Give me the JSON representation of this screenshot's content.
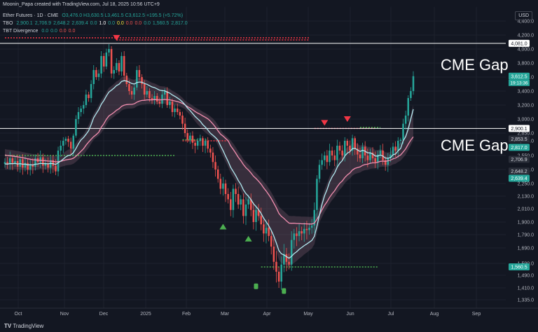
{
  "header": {
    "credit": "Moonin_Papa created with TradingView.com, Jul 18, 2025 10:56 UTC+9",
    "symbol_line": "Ether Futures · 1D · CME",
    "ohlc": "O3,476.0 H3,630.5 L3,461.5 C3,612.5 +195.5 (+5.72%)",
    "tbo_label": "TBO",
    "tbo_values": [
      "2,900.1",
      "2,706.9",
      "2,648.2",
      "2,639.4",
      "0.0",
      "1.0",
      "0.0",
      "0.0",
      "0.0",
      "0.0",
      "0.0",
      "1,560.5",
      "2,817.0"
    ],
    "tbt_label": "TBT Divergence",
    "tbt_values": [
      "0.0",
      "0.0",
      "0.0",
      "0.0"
    ]
  },
  "currency": "USD",
  "annotations": [
    "CME Gap",
    "CME Gap"
  ],
  "footer": "TradingView",
  "colors": {
    "bg": "#131722",
    "up": "#26a69a",
    "down": "#ef5350",
    "grid": "#1e222d",
    "text": "#b2b5be",
    "cloud": "#7a5a6e",
    "fast_ma": "#b2ebf2",
    "slow_ma": "#f48fb1",
    "dot_green": "#4caf50",
    "dot_red": "#f23645"
  },
  "chart_data": {
    "type": "candlestick",
    "x_ticks": [
      "Oct",
      "Nov",
      "Dec",
      "2025",
      "Feb",
      "Mar",
      "Apr",
      "May",
      "Jun",
      "Jul",
      "Aug",
      "Sep"
    ],
    "y_ticks": [
      1335,
      1410,
      1490,
      1590,
      1690,
      1790,
      1900,
      2010,
      2130,
      2250,
      2400,
      2550,
      2700,
      2850,
      3000,
      3200,
      3400,
      3600,
      3800,
      4000,
      4200,
      4400
    ],
    "y_tick_labels": [
      "1,335.0",
      "1,410.0",
      "1,490.0",
      "1,590.0",
      "1,690.0",
      "1,790.0",
      "1,900.0",
      "2,010.0",
      "2,130.0",
      "2,250.0",
      "2,400.0",
      "2,550.0",
      "2,700.0",
      "2,850.0",
      "3,000.0",
      "3,200.0",
      "3,400.0",
      "3,600.0",
      "3,800.0",
      "4,000.0",
      "4,200.0",
      "4,400.0"
    ],
    "last_price": 3612.5,
    "countdown": "19:13:36",
    "price_labels": [
      {
        "value": 4081.0,
        "label": "4,081.0",
        "style": "white"
      },
      {
        "value": 3612.5,
        "label": "3,612.5",
        "style": "up"
      },
      {
        "value": 2900.1,
        "label": "2,900.1",
        "style": "white"
      },
      {
        "value": 2853.5,
        "label": "2,853.5",
        "style": "dark"
      },
      {
        "value": 2817.0,
        "label": "2,817.0",
        "style": "up"
      },
      {
        "value": 2706.9,
        "label": "2,706.9",
        "style": "dark"
      },
      {
        "value": 2648.2,
        "label": "2,648.2",
        "style": "dark"
      },
      {
        "value": 2639.4,
        "label": "2,639.4",
        "style": "up"
      },
      {
        "value": 1560.5,
        "label": "1,560.5",
        "style": "up"
      }
    ],
    "gap_lines": [
      4081.0,
      2900.1
    ],
    "closes": [
      2480,
      2460,
      2520,
      2470,
      2490,
      2430,
      2510,
      2420,
      2470,
      2400,
      2450,
      2430,
      2520,
      2480,
      2530,
      2440,
      2460,
      2420,
      2500,
      2440,
      2380,
      2600,
      2650,
      2700,
      2740,
      2690,
      2620,
      2800,
      3000,
      3100,
      3150,
      3200,
      3350,
      3300,
      3500,
      3700,
      3600,
      3650,
      3900,
      3750,
      3950,
      4000,
      3650,
      3700,
      3800,
      3680,
      3900,
      3620,
      3500,
      3400,
      3350,
      3450,
      3700,
      3600,
      3500,
      3350,
      3400,
      3300,
      3280,
      3330,
      3250,
      3220,
      3350,
      3400,
      3200,
      3250,
      3100,
      3150,
      3100,
      3050,
      2950,
      2850,
      2720,
      2800,
      2680,
      2650,
      2700,
      2750,
      2650,
      2700,
      2620,
      2580,
      2480,
      2400,
      2300,
      2200,
      2250,
      2150,
      2100,
      2000,
      2200,
      2150,
      2050,
      2100,
      1950,
      2050,
      2100,
      2000,
      1900,
      2000,
      1950,
      1880,
      1800,
      1850,
      1780,
      1700,
      1600,
      1520,
      1450,
      1580,
      1650,
      1600,
      1580,
      1750,
      1800,
      1780,
      1820,
      1800,
      1840,
      1830,
      1850,
      1870,
      2000,
      2300,
      2450,
      2500,
      2550,
      2480,
      2600,
      2550,
      2500,
      2650,
      2600,
      2550,
      2700,
      2650,
      2600,
      2750,
      2620,
      2560,
      2520,
      2640,
      2550,
      2500,
      2580,
      2520,
      2480,
      2560,
      2600,
      2500,
      2450,
      2520,
      2560,
      2640,
      2600,
      2700,
      2720,
      2950,
      3050,
      3300,
      3400,
      3612.5
    ],
    "fast_ma": [
      2460,
      2458,
      2463,
      2462,
      2465,
      2459,
      2463,
      2456,
      2458,
      2450,
      2452,
      2449,
      2457,
      2459,
      2466,
      2463,
      2464,
      2461,
      2465,
      2463,
      2455,
      2471,
      2490,
      2512,
      2535,
      2550,
      2556,
      2579,
      2621,
      2669,
      2716,
      2764,
      2827,
      2875,
      2940,
      3018,
      3079,
      3136,
      3212,
      3264,
      3328,
      3386,
      3413,
      3442,
      3478,
      3498,
      3538,
      3548,
      3543,
      3527,
      3507,
      3501,
      3521,
      3529,
      3526,
      3508,
      3497,
      3477,
      3459,
      3449,
      3431,
      3412,
      3406,
      3405,
      3384,
      3371,
      3344,
      3325,
      3302,
      3276,
      3244,
      3205,
      3157,
      3123,
      3079,
      3036,
      3003,
      2977,
      2941,
      2915,
      2883,
      2849,
      2808,
      2763,
      2711,
      2650,
      2601,
      2543,
      2487,
      2423,
      2380,
      2335,
      2283,
      2242,
      2191,
      2155,
      2130,
      2097,
      2057,
      2031,
      2003,
      1971,
      1932,
      1902,
      1868,
      1828,
      1780,
      1727,
      1673,
      1652,
      1645,
      1634,
      1623,
      1636,
      1653,
      1665,
      1681,
      1693,
      1708,
      1720,
      1733,
      1747,
      1778,
      1863,
      1959,
      2049,
      2134,
      2193,
      2266,
      2321,
      2362,
      2425,
      2467,
      2495,
      2545,
      2574,
      2589,
      2621,
      2622,
      2608,
      2591,
      2603,
      2594,
      2577,
      2578,
      2565,
      2545,
      2544,
      2555,
      2544,
      2522,
      2521,
      2526,
      2557,
      2566,
      2597,
      2622,
      2700,
      2779,
      2896,
      3002,
      3141
    ],
    "slow_ma": [
      2555,
      2550,
      2548,
      2544,
      2540,
      2536,
      2531,
      2526,
      2521,
      2515,
      2510,
      2505,
      2503,
      2500,
      2499,
      2496,
      2494,
      2491,
      2490,
      2488,
      2482,
      2484,
      2488,
      2495,
      2503,
      2508,
      2511,
      2521,
      2542,
      2567,
      2592,
      2619,
      2656,
      2687,
      2730,
      2781,
      2821,
      2860,
      2913,
      2950,
      2998,
      3045,
      3069,
      3095,
      3126,
      3148,
      3182,
      3199,
      3207,
      3210,
      3210,
      3218,
      3241,
      3256,
      3266,
      3268,
      3274,
      3275,
      3274,
      3278,
      3276,
      3273,
      3276,
      3280,
      3276,
      3275,
      3266,
      3259,
      3250,
      3239,
      3223,
      3203,
      3177,
      3158,
      3133,
      3107,
      3086,
      3068,
      3045,
      3026,
      3003,
      2978,
      2948,
      2914,
      2875,
      2830,
      2791,
      2746,
      2700,
      2648,
      2612,
      2574,
      2531,
      2495,
      2453,
      2420,
      2395,
      2364,
      2328,
      2303,
      2275,
      2244,
      2208,
      2178,
      2144,
      2107,
      2064,
      2018,
      1971,
      1947,
      1930,
      1910,
      1891,
      1889,
      1890,
      1887,
      1887,
      1885,
      1885,
      1884,
      1883,
      1883,
      1891,
      1922,
      1959,
      2000,
      2043,
      2077,
      2118,
      2153,
      2181,
      2220,
      2252,
      2277,
      2314,
      2342,
      2363,
      2394,
      2412,
      2421,
      2428,
      2444,
      2453,
      2457,
      2467,
      2471,
      2471,
      2478,
      2487,
      2490,
      2488,
      2493,
      2500,
      2514,
      2522,
      2540,
      2556,
      2586,
      2618,
      2666,
      2714,
      2777
    ],
    "markers": [
      {
        "index": 44,
        "price": 4160,
        "kind": "triangle-down",
        "color": "#f23645"
      },
      {
        "index": 126,
        "price": 2960,
        "kind": "triangle-down",
        "color": "#f23645"
      },
      {
        "index": 135,
        "price": 3000,
        "kind": "triangle-down",
        "color": "#f23645"
      },
      {
        "index": 86,
        "price": 1860,
        "kind": "triangle-up",
        "color": "#4caf50"
      },
      {
        "index": 96,
        "price": 1760,
        "kind": "triangle-up",
        "color": "#4caf50"
      },
      {
        "index": 99,
        "price": 1420,
        "kind": "square",
        "color": "#4caf50"
      },
      {
        "index": 110,
        "price": 1390,
        "kind": "square",
        "color": "#4caf50"
      }
    ],
    "signal_levels": [
      {
        "price": 4160,
        "from": 0,
        "to": 120,
        "color": "#f23645"
      },
      {
        "price": 4130,
        "from": 44,
        "to": 120,
        "color": "#f23645"
      },
      {
        "price": 2550,
        "from": 0,
        "to": 67,
        "color": "#4caf50"
      },
      {
        "price": 2700,
        "from": 70,
        "to": 88,
        "color": "#f23645"
      },
      {
        "price": 2720,
        "from": 70,
        "to": 80,
        "color": "#4caf50"
      },
      {
        "price": 2900,
        "from": 122,
        "to": 146,
        "color": "#f23645"
      },
      {
        "price": 2910,
        "from": 140,
        "to": 148,
        "color": "#4caf50"
      },
      {
        "price": 1560,
        "from": 101,
        "to": 147,
        "color": "#4caf50"
      }
    ]
  }
}
